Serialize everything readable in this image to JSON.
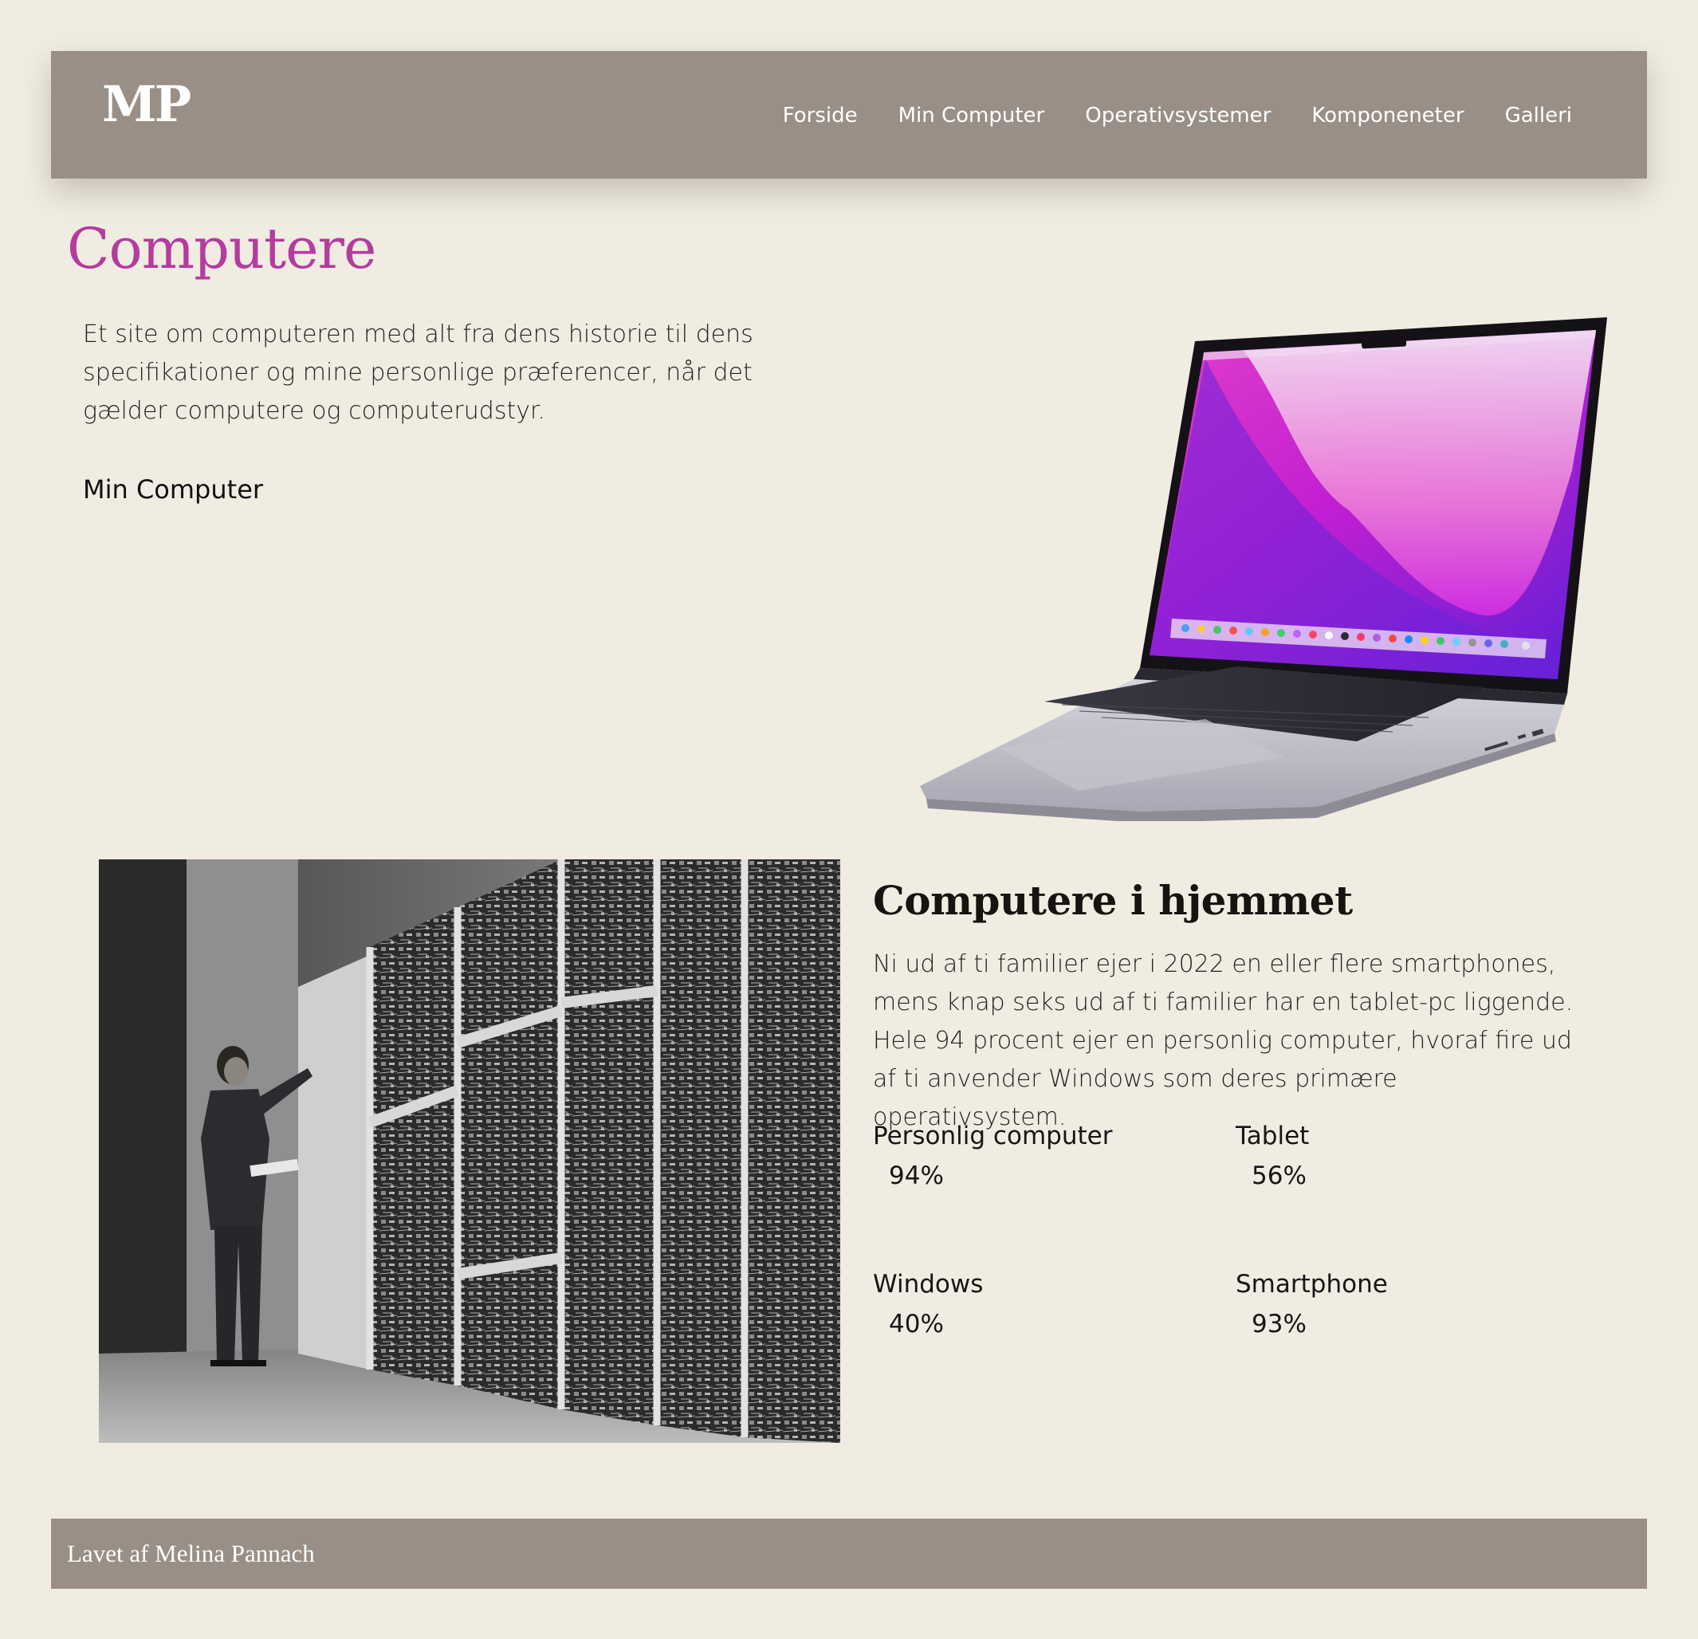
{
  "header": {
    "logo": "MP",
    "nav": [
      "Forside",
      "Min Computer",
      "Operativsystemer",
      "Komponeneter",
      "Galleri"
    ]
  },
  "hero": {
    "title": "Computere",
    "intro": "Et site om computeren med alt fra dens historie til dens specifikationer og mine personlige præferencer, når det gælder computere og computerudstyr.",
    "link": "Min Computer"
  },
  "home": {
    "title": "Computere i hjemmet",
    "text": "Ni ud af ti familier ejer i 2022 en eller flere smartphones, mens knap seks ud af ti familier har en tablet-pc liggende. Hele 94 procent ejer en personlig computer, hvoraf fire ud af ti anvender Windows som deres primære operativsystem.",
    "stats": [
      {
        "label": "Personlig computer",
        "value": "94%"
      },
      {
        "label": "Tablet",
        "value": "56%"
      },
      {
        "label": "Windows",
        "value": "40%"
      },
      {
        "label": "Smartphone",
        "value": "93%"
      }
    ]
  },
  "footer": {
    "text": "Lavet af Melina Pannach"
  },
  "colors": {
    "background": "#f0ece1",
    "header_bg": "#998f86",
    "title_accent": "#b43c9e"
  }
}
